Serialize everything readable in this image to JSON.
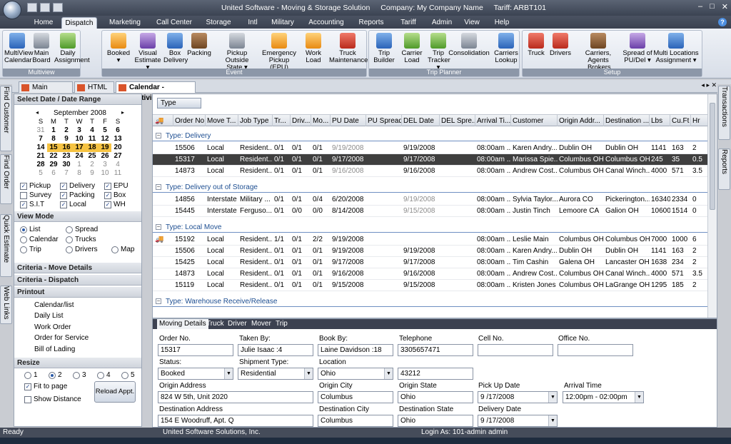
{
  "window": {
    "app_title": "United Software - Moving & Storage Solution",
    "company": "Company: My Company Name",
    "tariff": "Tariff: ARBT101",
    "minimize": "–",
    "maximize": "□",
    "close": "✕"
  },
  "menu_tabs": [
    "Home",
    "Dispatch",
    "Marketing",
    "Call Center",
    "Storage",
    "Intl",
    "Military",
    "Accounting",
    "Reports",
    "Tariff",
    "Admin",
    "View",
    "Help"
  ],
  "help_label": "?",
  "ribbon": {
    "groups": [
      {
        "label": "Multiview",
        "buttons": [
          {
            "l1": "MultiView",
            "l2": "Calendar",
            "icon": "calendar-icon"
          },
          {
            "l1": "Main",
            "l2": "Board",
            "icon": "board-icon"
          },
          {
            "l1": "Daily",
            "l2": "Assignment",
            "icon": "assignment-icon"
          }
        ]
      },
      {
        "label": "Event",
        "buttons": [
          {
            "l1": "Booked",
            "l2": "▾",
            "icon": "booked-icon"
          },
          {
            "l1": "Visual",
            "l2": "Estimate ▾",
            "icon": "estimate-icon"
          },
          {
            "l1": "Box",
            "l2": "Delivery",
            "icon": "box-icon"
          },
          {
            "l1": "Packing",
            "l2": "",
            "icon": "packing-icon"
          },
          {
            "l1": "Pickup Outside",
            "l2": "State ▾",
            "icon": "road-icon"
          },
          {
            "l1": "Emergency",
            "l2": "Pickup (EPU)",
            "icon": "warning-icon"
          },
          {
            "l1": "Work",
            "l2": "Load",
            "icon": "workload-icon"
          },
          {
            "l1": "Truck",
            "l2": "Maintenance",
            "icon": "truck-maintenance-icon"
          }
        ]
      },
      {
        "label": "Trip Planner",
        "buttons": [
          {
            "l1": "Trip",
            "l2": "Builder",
            "icon": "trip-builder-icon"
          },
          {
            "l1": "Carrier",
            "l2": "Load",
            "icon": "carrier-load-icon"
          },
          {
            "l1": "Trip",
            "l2": "Tracker ▾",
            "icon": "trip-tracker-icon"
          },
          {
            "l1": "Consolidation",
            "l2": "",
            "icon": "consolidation-icon"
          },
          {
            "l1": "Carriers",
            "l2": "Lookup",
            "icon": "carriers-lookup-icon"
          }
        ]
      },
      {
        "label": "Setup",
        "buttons": [
          {
            "l1": "Truck",
            "l2": "",
            "icon": "truck-icon"
          },
          {
            "l1": "Drivers",
            "l2": "",
            "icon": "drivers-icon"
          },
          {
            "l1": "Carriers, Agents",
            "l2": ",Brokers",
            "icon": "agents-icon"
          },
          {
            "l1": "Spread of",
            "l2": "PU/Del ▾",
            "icon": "spread-icon"
          },
          {
            "l1": "Multi Locations",
            "l2": "Assignment ▾",
            "icon": "globe-icon"
          }
        ]
      }
    ]
  },
  "work_tabs": [
    "Main Screen",
    "HTML",
    "Calendar - Multiview"
  ],
  "left_vtabs": [
    "Find Customer",
    "Find Order",
    "Quick Estimate",
    "Web Links"
  ],
  "right_vtabs": [
    "Transactions",
    "Reports"
  ],
  "left_panel": {
    "date_header": "Select Date / Date Range",
    "month": "September 2008",
    "day_headers": [
      "S",
      "M",
      "T",
      "W",
      "T",
      "F",
      "S"
    ],
    "weeks": [
      [
        "31",
        "1",
        "2",
        "3",
        "4",
        "5",
        "6"
      ],
      [
        "7",
        "8",
        "9",
        "10",
        "11",
        "12",
        "13"
      ],
      [
        "14",
        "15",
        "16",
        "17",
        "18",
        "19",
        "20"
      ],
      [
        "21",
        "22",
        "23",
        "24",
        "25",
        "26",
        "27"
      ],
      [
        "28",
        "29",
        "30",
        "1",
        "2",
        "3",
        "4"
      ],
      [
        "5",
        "6",
        "7",
        "8",
        "9",
        "10",
        "11"
      ]
    ],
    "checks": [
      {
        "label": "Pickup",
        "checked": true
      },
      {
        "label": "Delivery",
        "checked": true
      },
      {
        "label": "EPU",
        "checked": true
      },
      {
        "label": "Survey",
        "checked": false
      },
      {
        "label": "Packing",
        "checked": true
      },
      {
        "label": "Box",
        "checked": true
      },
      {
        "label": "S.I.T",
        "checked": true
      },
      {
        "label": "Local",
        "checked": true
      },
      {
        "label": "WH",
        "checked": true
      }
    ],
    "view_mode_header": "View Mode",
    "view_modes": [
      "List",
      "Spread",
      "Calendar",
      "Trucks",
      "Trip",
      "Drivers",
      "Map"
    ],
    "criteria_move": "Criteria - Move Details",
    "criteria_dispatch": "Criteria - Dispatch",
    "printout_header": "Printout",
    "printouts": [
      "Calendar/list",
      "Daily List",
      "Work Order",
      "Order for Service",
      "Bill of Lading"
    ],
    "resize_header": "Resize",
    "resize_options": [
      "1",
      "2",
      "3",
      "4",
      "5"
    ],
    "fit_to_page": "Fit to page",
    "show_distance": "Show Distance",
    "reload": "Reload Appt."
  },
  "grid": {
    "type_button": "Type",
    "columns": [
      "Order No.",
      "Move T...",
      "Job Type",
      "Tr...",
      "Driv...",
      "Mo...",
      "PU Date",
      "PU Spread",
      "DEL Date",
      "DEL Spre...",
      "Arrival Ti...",
      "Customer",
      "Origin Addr...",
      "Destination ...",
      "Lbs",
      "Cu.Ft",
      "Hr"
    ],
    "groups": [
      {
        "title": "Type: Delivery",
        "rows": [
          [
            "15506",
            "Local",
            "Resident...",
            "0/1",
            "0/1",
            "0/1",
            "9/19/2008",
            "",
            "9/19/2008",
            "",
            "08:00am ...",
            "Karen Andry...",
            "Dublin OH",
            "Dublin OH",
            "1141",
            "163",
            "2"
          ],
          [
            "15317",
            "Local",
            "Resident...",
            "0/1",
            "0/1",
            "0/1",
            "9/17/2008",
            "",
            "9/17/2008",
            "",
            "08:00am ...",
            "Marissa Spie...",
            "Columbus OH",
            "Columbus OH",
            "245",
            "35",
            "0.5"
          ],
          [
            "14873",
            "Local",
            "Resident...",
            "0/1",
            "0/1",
            "0/1",
            "9/16/2008",
            "",
            "9/16/2008",
            "",
            "08:00am ...",
            "Andrew Cost...",
            "Columbus OH",
            "Canal Winch...",
            "4000",
            "571",
            "3.5"
          ]
        ]
      },
      {
        "title": "Type: Delivery out of Storage",
        "rows": [
          [
            "14856",
            "Interstate",
            "Military ...",
            "0/1",
            "0/1",
            "0/4",
            "6/20/2008",
            "",
            "9/19/2008",
            "",
            "08:00am ...",
            "Sylvia Taylor...",
            "Aurora CO",
            "Pickerington...",
            "16340",
            "2334",
            "0"
          ],
          [
            "15445",
            "Interstate",
            "Ferguso...",
            "0/1",
            "0/0",
            "0/0",
            "8/14/2008",
            "",
            "9/15/2008",
            "",
            "08:00am ...",
            "Justin Tinch",
            "Lemoore CA",
            "Galion OH",
            "10600",
            "1514",
            "0"
          ]
        ]
      },
      {
        "title": "Type: Local Move",
        "rows": [
          [
            "15192",
            "Local",
            "Resident...",
            "1/1",
            "0/1",
            "2/2",
            "9/19/2008",
            "",
            "",
            "",
            "08:00am ...",
            "Leslie Main",
            "Columbus OH",
            "Columbus OH",
            "7000",
            "1000",
            "6"
          ],
          [
            "15506",
            "Local",
            "Resident...",
            "0/1",
            "0/1",
            "0/1",
            "9/19/2008",
            "",
            "9/19/2008",
            "",
            "08:00am ...",
            "Karen Andry...",
            "Dublin OH",
            "Dublin OH",
            "1141",
            "163",
            "2"
          ],
          [
            "15425",
            "Local",
            "Resident...",
            "0/1",
            "0/1",
            "0/1",
            "9/17/2008",
            "",
            "9/17/2008",
            "",
            "08:00am ...",
            "Tim Cashin",
            "Galena OH",
            "Lancaster OH",
            "1638",
            "234",
            "2"
          ],
          [
            "14873",
            "Local",
            "Resident...",
            "0/1",
            "0/1",
            "0/1",
            "9/16/2008",
            "",
            "9/16/2008",
            "",
            "08:00am ...",
            "Andrew Cost...",
            "Columbus OH",
            "Canal Winch...",
            "4000",
            "571",
            "3.5"
          ],
          [
            "15119",
            "Local",
            "Resident...",
            "0/1",
            "0/1",
            "0/1",
            "9/15/2008",
            "",
            "9/15/2008",
            "",
            "08:00am ...",
            "Kristen Jones",
            "Columbus OH",
            "LaGrange OH",
            "1295",
            "185",
            "2"
          ]
        ]
      },
      {
        "title": "Type: Warehouse Receive/Release",
        "rows": []
      }
    ]
  },
  "details": {
    "tabs": [
      "Moving Details",
      "Truck",
      "Driver",
      "Mover",
      "Trip"
    ],
    "order_no_label": "Order No.",
    "order_no": "15317",
    "taken_by_label": "Taken By:",
    "taken_by": "Julie Isaac :4",
    "book_by_label": "Book By:",
    "book_by": "Laine Davidson :18",
    "telephone_label": "Telephone",
    "telephone": "3305657471",
    "cell_label": "Cell No.",
    "cell": "",
    "office_label": "Office No.",
    "office": "",
    "status_label": "Status:",
    "status": "Booked",
    "shipment_type_label": "Shipment Type:",
    "shipment_type": "Residential",
    "location_label": "Location",
    "location": "Ohio",
    "zip": "43212",
    "origin_address_label": "Origin Address",
    "origin_address": "824 W 5th, Unit 2020",
    "origin_city_label": "Origin City",
    "origin_city": "Columbus",
    "origin_state_label": "Origin State",
    "origin_state": "Ohio",
    "pickup_date_label": "Pick Up Date",
    "pickup_date": "9 /17/2008",
    "arrival_time_label": "Arrival Time",
    "arrival_time": "12:00pm - 02:00pm",
    "dest_address_label": "Destination Address",
    "dest_address": "154 E Woodruff, Apt. Q",
    "dest_city_label": "Destination City",
    "dest_city": "Columbus",
    "dest_state_label": "Destination State",
    "dest_state": "Ohio",
    "delivery_date_label": "Delivery Date",
    "delivery_date": "9 /17/2008"
  },
  "status": {
    "ready": "Ready",
    "company": "United Software Solutions, Inc.",
    "login": "Login As: 101-admin admin"
  }
}
